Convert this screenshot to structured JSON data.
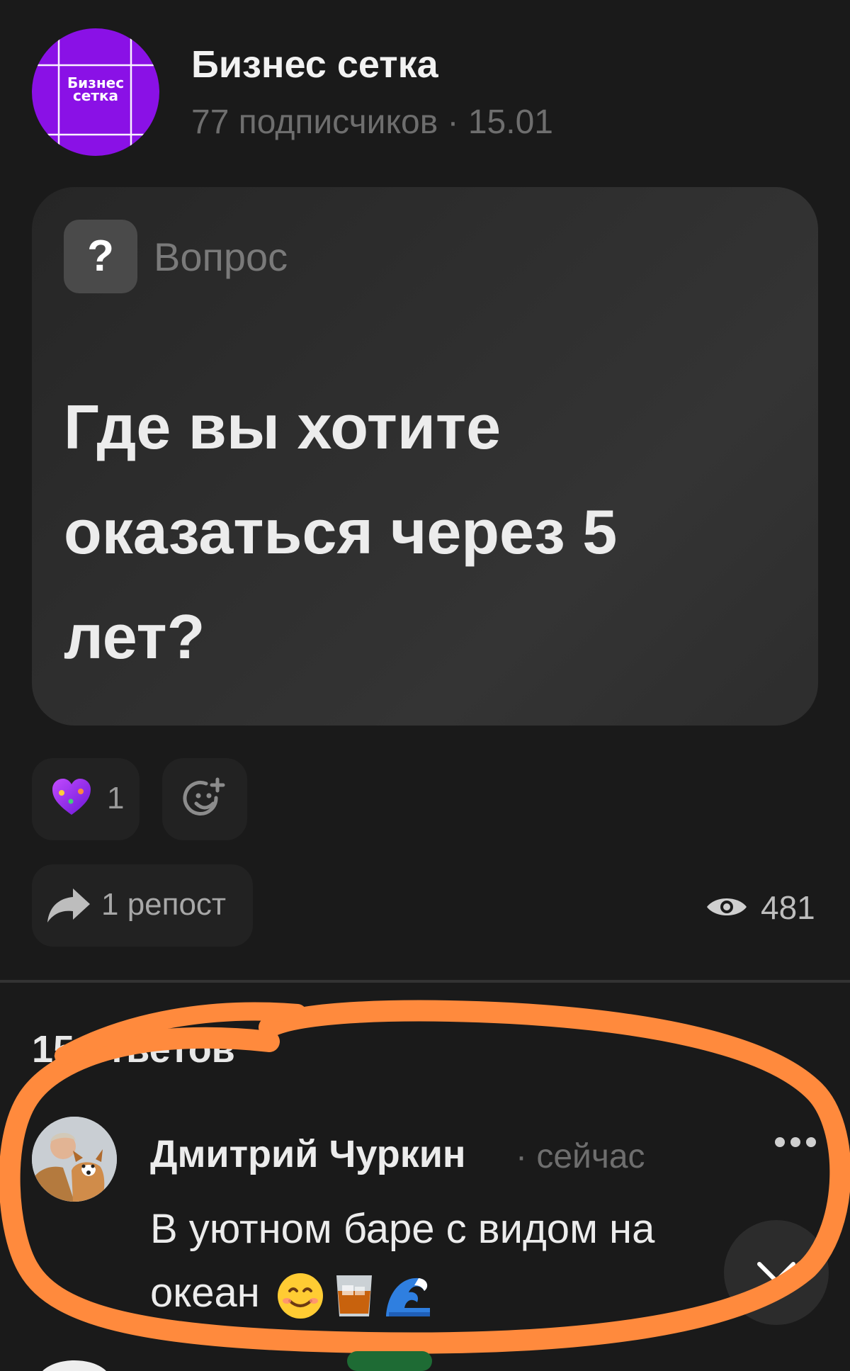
{
  "channel": {
    "avatar_text": "Бизнес\nсетка",
    "name": "Бизнес сетка",
    "meta": "77 подписчиков · 15.01"
  },
  "post": {
    "type_icon": "?",
    "type_label": "Вопрос",
    "question": "Где вы хотите оказаться через 5 лет?"
  },
  "actions": {
    "reaction_count": "1",
    "repost_label": "1 репост",
    "views": "481"
  },
  "replies": {
    "count_label": "15 ответов"
  },
  "comment": {
    "author": "Дмитрий Чуркин",
    "time": "· сейчас",
    "text": "В уютном баре с видом на океан",
    "emojis": [
      "smiling-face",
      "whisky-glass",
      "wave"
    ]
  },
  "colors": {
    "brand_purple": "#8a11e6",
    "annotation_orange": "#ff8a3d",
    "background": "#1a1a1a"
  }
}
